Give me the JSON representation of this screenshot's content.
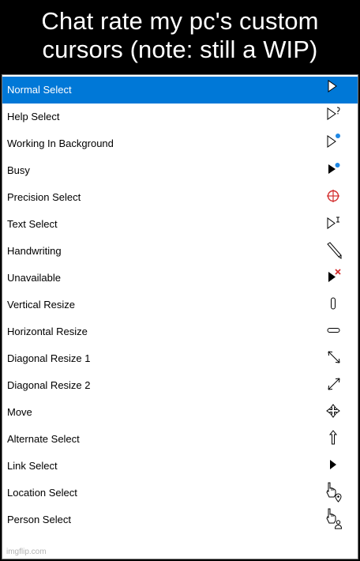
{
  "caption": "Chat rate my pc's custom cursors (note: still a WIP)",
  "cursors": [
    {
      "label": "Normal Select",
      "icon": "normal-select-cursor-icon"
    },
    {
      "label": "Help Select",
      "icon": "help-select-cursor-icon"
    },
    {
      "label": "Working In Background",
      "icon": "working-in-background-cursor-icon"
    },
    {
      "label": "Busy",
      "icon": "busy-cursor-icon"
    },
    {
      "label": "Precision Select",
      "icon": "precision-select-cursor-icon"
    },
    {
      "label": "Text Select",
      "icon": "text-select-cursor-icon"
    },
    {
      "label": "Handwriting",
      "icon": "handwriting-cursor-icon"
    },
    {
      "label": "Unavailable",
      "icon": "unavailable-cursor-icon"
    },
    {
      "label": "Vertical Resize",
      "icon": "vertical-resize-cursor-icon"
    },
    {
      "label": "Horizontal Resize",
      "icon": "horizontal-resize-cursor-icon"
    },
    {
      "label": "Diagonal Resize 1",
      "icon": "diagonal-resize-1-cursor-icon"
    },
    {
      "label": "Diagonal Resize 2",
      "icon": "diagonal-resize-2-cursor-icon"
    },
    {
      "label": "Move",
      "icon": "move-cursor-icon"
    },
    {
      "label": "Alternate Select",
      "icon": "alternate-select-cursor-icon"
    },
    {
      "label": "Link Select",
      "icon": "link-select-cursor-icon"
    },
    {
      "label": "Location Select",
      "icon": "location-select-cursor-icon"
    },
    {
      "label": "Person Select",
      "icon": "person-select-cursor-icon"
    }
  ],
  "selected_index": 0,
  "colors": {
    "selection": "#0078d7",
    "busy_dot": "#1e88e5",
    "precision": "#d32f2f",
    "unavailable_x": "#d32f2f"
  },
  "watermark": "imgflip.com"
}
